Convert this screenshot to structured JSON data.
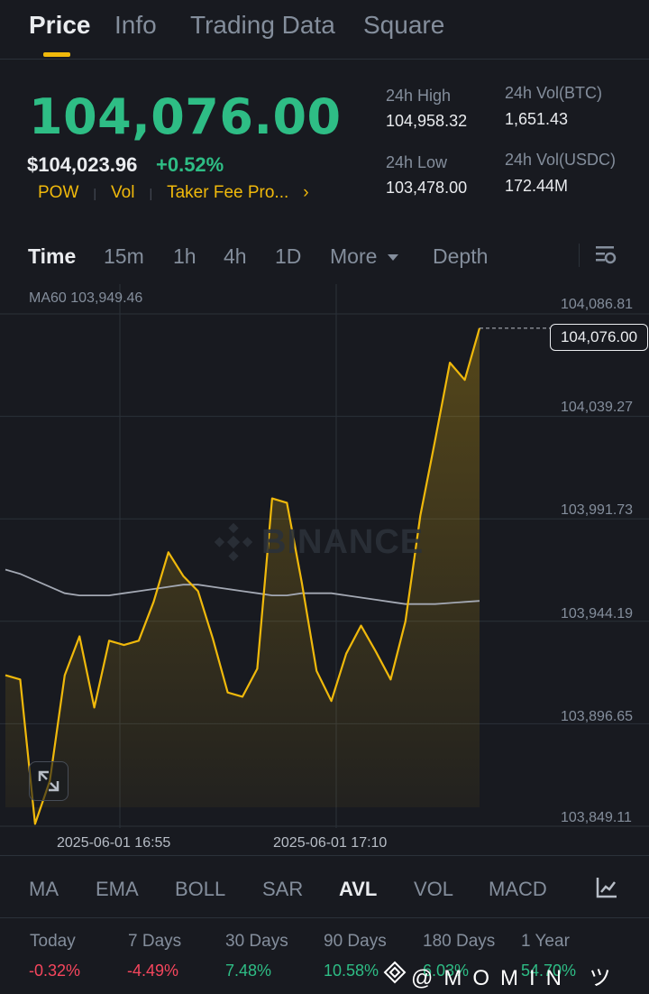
{
  "tabs": [
    {
      "label": "Price"
    },
    {
      "label": "Info"
    },
    {
      "label": "Trading Data"
    },
    {
      "label": "Square"
    }
  ],
  "ticker": {
    "last_price": "104,076.00",
    "usd_price": "$104,023.96",
    "change": "+0.52%",
    "tags": [
      "POW",
      "Vol",
      "Taker Fee Pro..."
    ],
    "tags_chevron": "›",
    "high_label": "24h High",
    "high_value": "104,958.32",
    "low_label": "24h Low",
    "low_value": "103,478.00",
    "vol_btc_label": "24h Vol(BTC)",
    "vol_btc_value": "1,651.43",
    "vol_usdc_label": "24h Vol(USDC)",
    "vol_usdc_value": "172.44M"
  },
  "timeframes": [
    {
      "label": "Time"
    },
    {
      "label": "15m"
    },
    {
      "label": "1h"
    },
    {
      "label": "4h"
    },
    {
      "label": "1D"
    },
    {
      "label": "More"
    },
    {
      "label": "Depth"
    }
  ],
  "chart": {
    "ma_label": "MA60 103,949.46",
    "watermark": "BINANCE",
    "y_ticks": [
      "104,086.81",
      "104,039.27",
      "103,991.73",
      "103,944.19",
      "103,896.65",
      "103,849.11"
    ],
    "current_price_tag": "104,076.00",
    "time_labels": [
      "2025-06-01 16:55",
      "2025-06-01 17:10"
    ]
  },
  "chart_data": {
    "type": "area",
    "ylim": [
      103849.11,
      104086.81
    ],
    "y_ticks": [
      104086.81,
      104039.27,
      103991.73,
      103944.19,
      103896.65,
      103849.11
    ],
    "x_labels": [
      "2025-06-01 16:55",
      "2025-06-01 17:10"
    ],
    "series": [
      {
        "name": "Time",
        "values": [
          103915,
          103913,
          103846,
          103866,
          103915,
          103933,
          103900,
          103931,
          103929,
          103931,
          103949,
          103972,
          103961,
          103954,
          103932,
          103907,
          103905,
          103918,
          103997,
          103995,
          103958,
          103917,
          103903,
          103925,
          103938,
          103926,
          103913,
          103940,
          103989,
          104024,
          104060,
          104052,
          104076
        ]
      },
      {
        "name": "MA60",
        "values": [
          103964,
          103962,
          103959,
          103956,
          103953,
          103952,
          103952,
          103952,
          103953,
          103954,
          103955,
          103956,
          103957,
          103957,
          103956,
          103955,
          103954,
          103953,
          103952,
          103952,
          103953,
          103953,
          103953,
          103952,
          103951,
          103950,
          103949,
          103948,
          103948,
          103948,
          103948.5,
          103949,
          103949.46
        ]
      }
    ],
    "colors": {
      "price_line": "#f0b90b",
      "ma_line": "#a3a8b3"
    }
  },
  "indicators": [
    {
      "label": "MA"
    },
    {
      "label": "EMA"
    },
    {
      "label": "BOLL"
    },
    {
      "label": "SAR"
    },
    {
      "label": "AVL"
    },
    {
      "label": "VOL"
    },
    {
      "label": "MACD"
    }
  ],
  "performance": [
    {
      "label": "Today",
      "value": "-0.32%",
      "dir": "neg"
    },
    {
      "label": "7 Days",
      "value": "-4.49%",
      "dir": "neg"
    },
    {
      "label": "30 Days",
      "value": "7.48%",
      "dir": "pos"
    },
    {
      "label": "90 Days",
      "value": "10.58%",
      "dir": "pos"
    },
    {
      "label": "180 Days",
      "value": "6.03%",
      "dir": "pos"
    },
    {
      "label": "1 Year",
      "value": "54.70%",
      "dir": "pos"
    }
  ],
  "overlay": {
    "text": "@MOMIN ツ"
  },
  "colors": {
    "accent": "#f0b90b",
    "up": "#2ebd85",
    "down": "#f6465d",
    "bg": "#181a20"
  }
}
